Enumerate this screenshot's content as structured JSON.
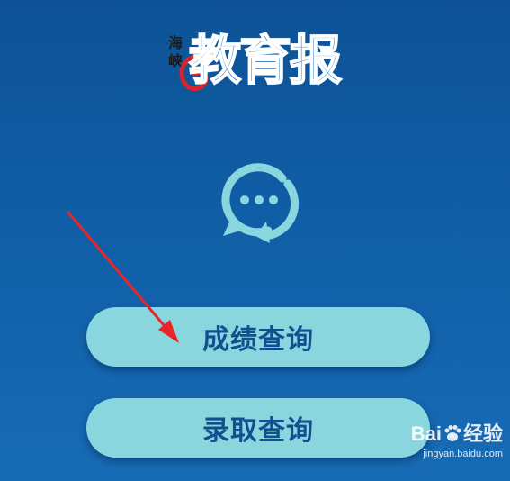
{
  "logo": {
    "small_text": "海峡",
    "main_text": "教育报"
  },
  "icons": {
    "chat": "chat-refresh-icon"
  },
  "buttons": {
    "score_query": "成绩查询",
    "admission_query": "录取查询"
  },
  "watermark": {
    "brand_left": "Bai",
    "brand_right": "经验",
    "site": "jingyan.baidu.com"
  },
  "colors": {
    "background": "#0f5ea6",
    "button_fill": "#8ad6de",
    "button_text": "#10508f",
    "icon": "#8ad6de",
    "arrow": "#e8262a",
    "logo_swirl": "#d4262b"
  }
}
